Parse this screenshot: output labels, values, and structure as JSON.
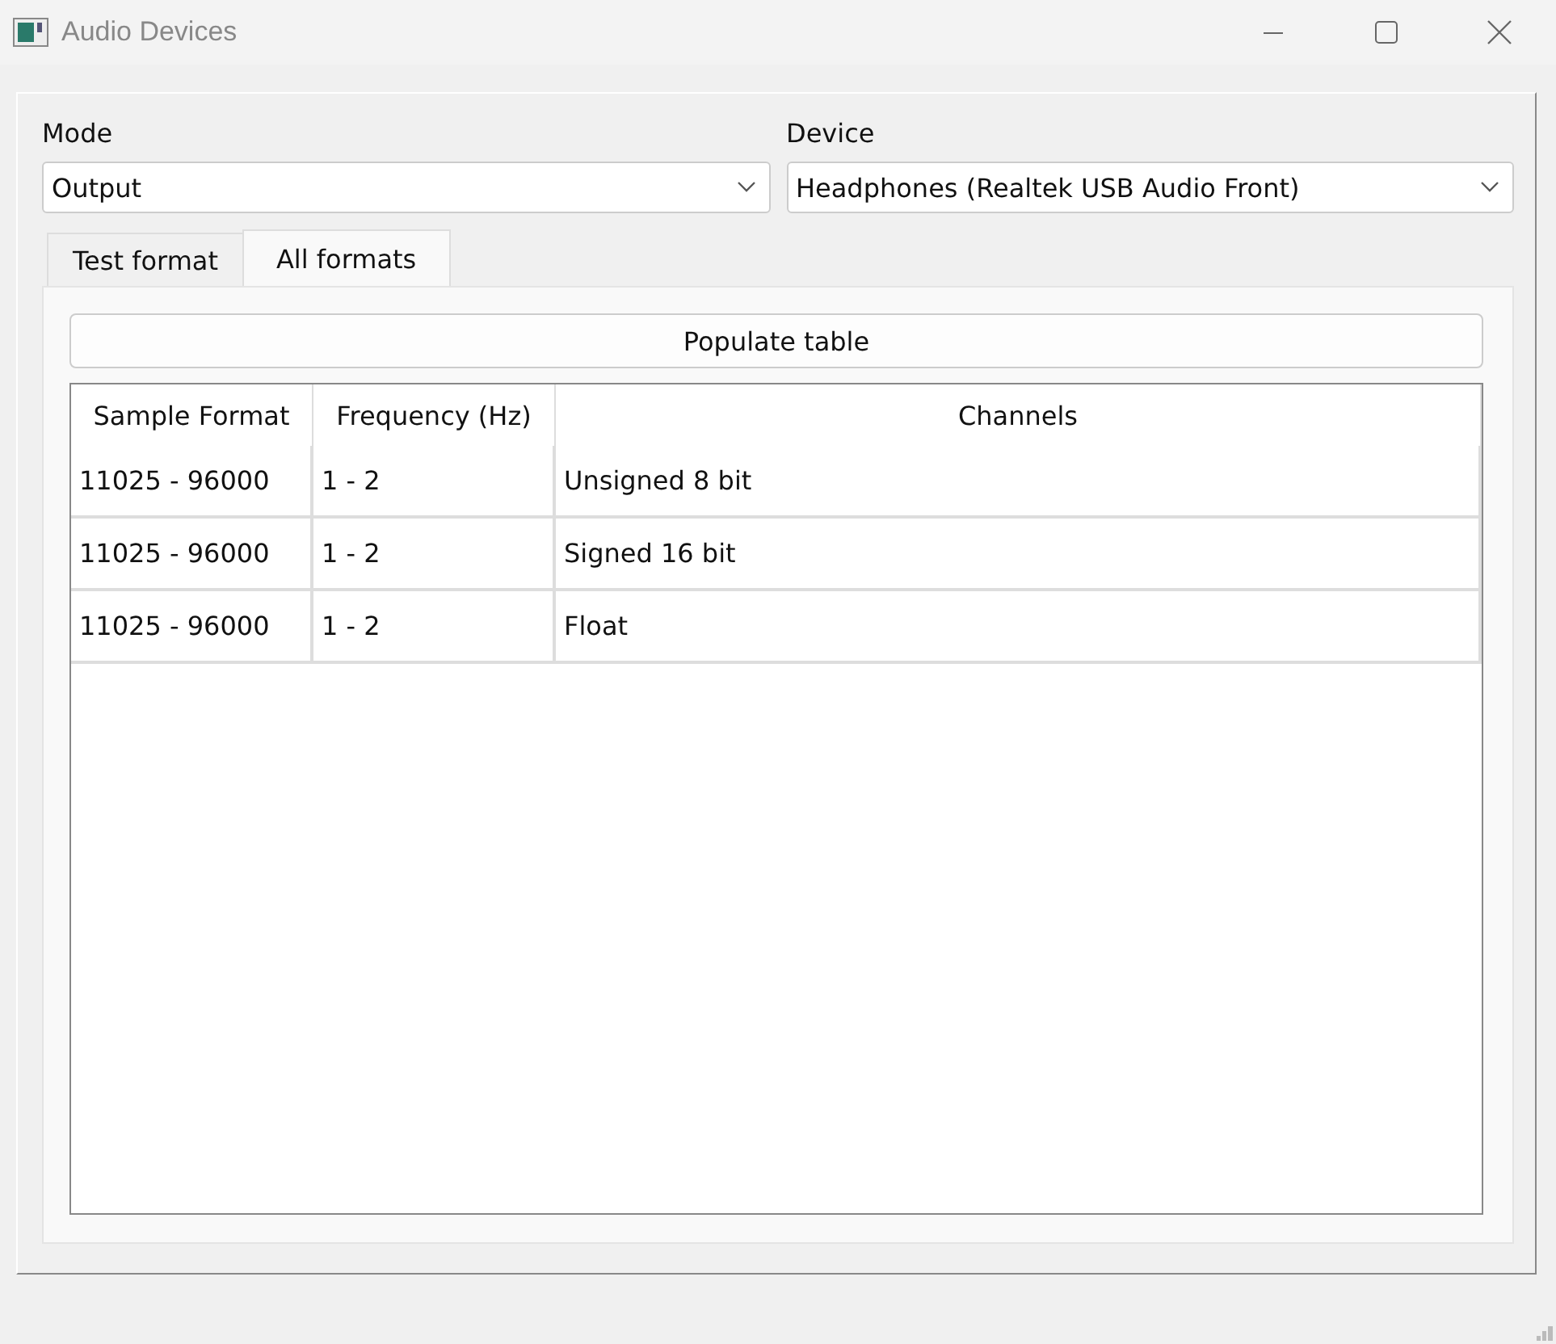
{
  "window": {
    "title": "Audio Devices"
  },
  "mode": {
    "label": "Mode",
    "value": "Output"
  },
  "device": {
    "label": "Device",
    "value": "Headphones (Realtek USB Audio Front)"
  },
  "tabs": [
    {
      "label": "Test format",
      "selected": false
    },
    {
      "label": "All formats",
      "selected": true
    }
  ],
  "populate_button": "Populate table",
  "table": {
    "columns": [
      "Sample Format",
      "Frequency (Hz)",
      "Channels"
    ],
    "rows": [
      [
        "11025 - 96000",
        "1 - 2",
        "Unsigned 8 bit"
      ],
      [
        "11025 - 96000",
        "1 - 2",
        "Signed 16 bit"
      ],
      [
        "11025 - 96000",
        "1 - 2",
        "Float"
      ]
    ]
  }
}
